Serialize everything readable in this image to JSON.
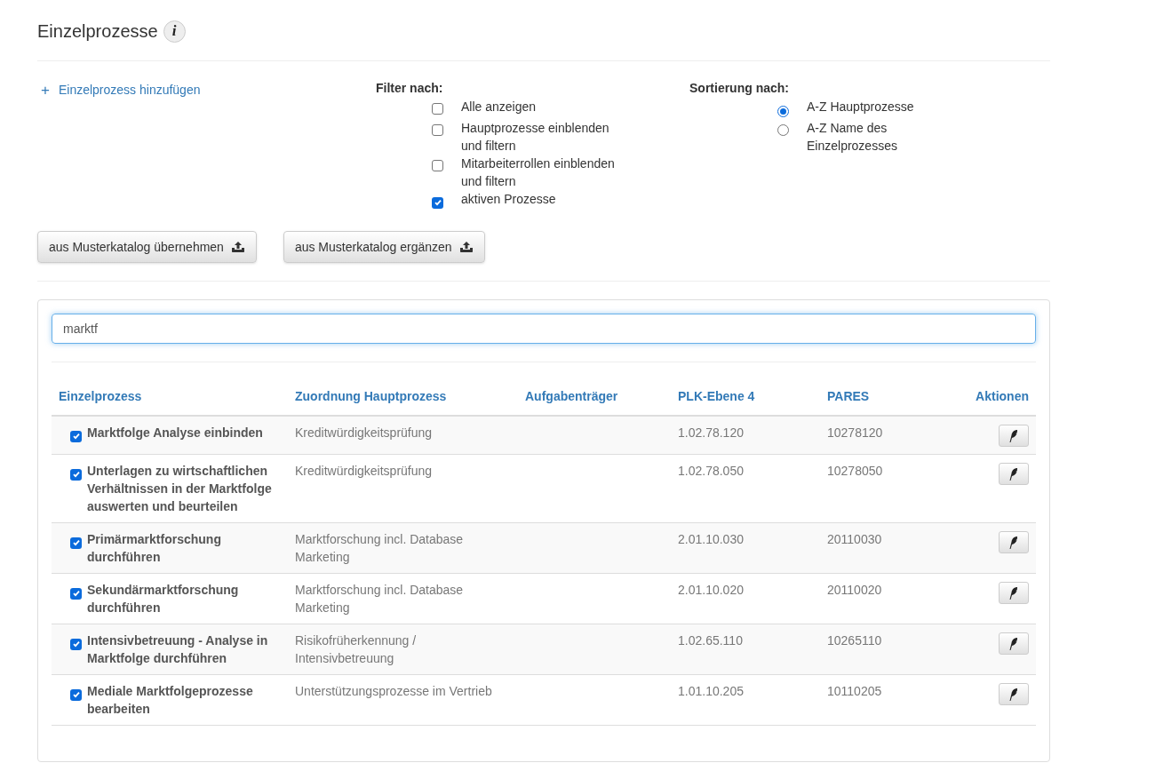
{
  "title": "Einzelprozesse",
  "info_icon": "i",
  "add_link": {
    "icon": "+",
    "label": "Einzelprozess hinzufügen"
  },
  "filter": {
    "heading": "Filter nach:",
    "options": [
      {
        "label": "Alle anzeigen",
        "checked": false
      },
      {
        "label": "Hauptprozesse einblenden und filtern",
        "checked": false
      },
      {
        "label": "Mitarbeiterrollen einblenden und filtern",
        "checked": false
      },
      {
        "label": "aktiven Prozesse",
        "checked": true
      }
    ]
  },
  "sort": {
    "heading": "Sortierung nach:",
    "options": [
      {
        "label": "A-Z Hauptprozesse",
        "selected": true
      },
      {
        "label": "A-Z Name des Einzelprozesses",
        "selected": false
      }
    ]
  },
  "buttons": [
    "aus Musterkatalog übernehmen",
    "aus Musterkatalog ergänzen"
  ],
  "search": {
    "value": "marktf"
  },
  "table": {
    "columns": [
      "Einzelprozess",
      "Zuordnung Hauptprozess",
      "Aufgabenträger",
      "PLK-Ebene 4",
      "PARES",
      "Aktionen"
    ],
    "rows": [
      {
        "checked": true,
        "name": "Marktfolge Analyse einbinden",
        "main": "Kreditwürdigkeitsprüfung",
        "plk": "1.02.78.120",
        "pares": "10278120"
      },
      {
        "checked": true,
        "name": "Unterlagen zu wirtschaftlichen Verhältnissen in der Marktfolge auswerten und beurteilen",
        "main": "Kreditwürdigkeitsprüfung",
        "plk": "1.02.78.050",
        "pares": "10278050"
      },
      {
        "checked": true,
        "name": "Primärmarktforschung durchführen",
        "main": "Marktforschung incl. Database Marketing",
        "plk": "2.01.10.030",
        "pares": "20110030"
      },
      {
        "checked": true,
        "name": "Sekundärmarktforschung durchführen",
        "main": "Marktforschung incl. Database Marketing",
        "plk": "2.01.10.020",
        "pares": "20110020"
      },
      {
        "checked": true,
        "name": "Intensivbetreuung - Analyse in Marktfolge durchführen",
        "main": "Risikofrüherkennung / Intensivbetreuung",
        "plk": "1.02.65.110",
        "pares": "10265110"
      },
      {
        "checked": true,
        "name": "Mediale Marktfolgeprozesse bearbeiten",
        "main": "Unterstützungsprozesse im Vertrieb",
        "plk": "1.01.10.205",
        "pares": "10110205"
      }
    ]
  }
}
